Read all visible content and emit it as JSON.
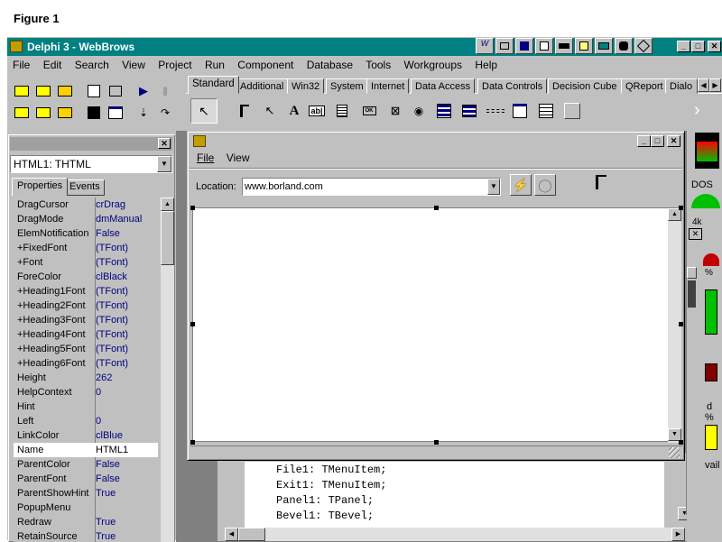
{
  "figure_label": "Figure 1",
  "app": {
    "title": "Delphi 3 - WebBrows",
    "menu": [
      "File",
      "Edit",
      "Search",
      "View",
      "Project",
      "Run",
      "Component",
      "Database",
      "Tools",
      "Workgroups",
      "Help"
    ]
  },
  "palette": {
    "tabs": [
      "Standard",
      "Additional",
      "Win32",
      "System",
      "Internet",
      "Data Access",
      "Data Controls",
      "Decision Cube",
      "QReport",
      "Dialo"
    ],
    "active_tab": "Standard",
    "label_text": "A",
    "edit_text": "ab|",
    "button_text": "OK"
  },
  "inspector": {
    "object": "HTML1: THTML",
    "tabs": [
      "Properties",
      "Events"
    ],
    "rows": [
      {
        "name": "DragCursor",
        "value": "crDrag"
      },
      {
        "name": "DragMode",
        "value": "dmManual"
      },
      {
        "name": "ElemNotification",
        "value": "False"
      },
      {
        "name": "+FixedFont",
        "value": "(TFont)"
      },
      {
        "name": "+Font",
        "value": "(TFont)"
      },
      {
        "name": "ForeColor",
        "value": "clBlack"
      },
      {
        "name": "+Heading1Font",
        "value": "(TFont)"
      },
      {
        "name": "+Heading2Font",
        "value": "(TFont)"
      },
      {
        "name": "+Heading3Font",
        "value": "(TFont)"
      },
      {
        "name": "+Heading4Font",
        "value": "(TFont)"
      },
      {
        "name": "+Heading5Font",
        "value": "(TFont)"
      },
      {
        "name": "+Heading6Font",
        "value": "(TFont)"
      },
      {
        "name": "Height",
        "value": "262"
      },
      {
        "name": "HelpContext",
        "value": "0"
      },
      {
        "name": "Hint",
        "value": ""
      },
      {
        "name": "Left",
        "value": "0"
      },
      {
        "name": "LinkColor",
        "value": "clBlue"
      },
      {
        "name": "Name",
        "value": "HTML1",
        "selected": true
      },
      {
        "name": "ParentColor",
        "value": "False"
      },
      {
        "name": "ParentFont",
        "value": "False"
      },
      {
        "name": "ParentShowHint",
        "value": "True"
      },
      {
        "name": "PopupMenu",
        "value": ""
      },
      {
        "name": "Redraw",
        "value": "True"
      },
      {
        "name": "RetainSource",
        "value": "True"
      }
    ]
  },
  "form": {
    "menu": [
      "File",
      "View"
    ],
    "location_label": "Location:",
    "location_value": "www.borland.com"
  },
  "code": {
    "lines": [
      "File1: TMenuItem;",
      "Exit1: TMenuItem;",
      "Panel1: TPanel;",
      "Bevel1: TBevel;"
    ]
  },
  "right_panel": {
    "dos_label": "DOS",
    "work_label": "vail",
    "tiny1": "4k",
    "tiny2": "%",
    "tiny3": "d",
    "tiny4": "%"
  },
  "colors": {
    "title_bar": "#008080",
    "window_face": "#c0c0c0",
    "value_text": "#000080",
    "desktop": "#808080"
  }
}
